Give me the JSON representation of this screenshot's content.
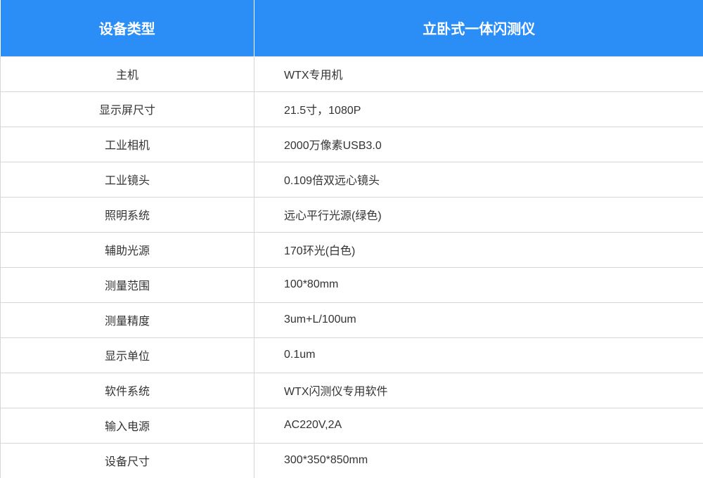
{
  "header": {
    "col1": "设备类型",
    "col2": "立卧式一体闪测仪"
  },
  "rows": [
    {
      "label": "主机",
      "value": "WTX专用机"
    },
    {
      "label": "显示屏尺寸",
      "value": "21.5寸，1080P"
    },
    {
      "label": "工业相机",
      "value": "2000万像素USB3.0"
    },
    {
      "label": "工业镜头",
      "value": "0.109倍双远心镜头"
    },
    {
      "label": "照明系统",
      "value": "远心平行光源(绿色)"
    },
    {
      "label": "辅助光源",
      "value": "170环光(白色)"
    },
    {
      "label": "测量范围",
      "value": "100*80mm"
    },
    {
      "label": "测量精度",
      "value": "3um+L/100um"
    },
    {
      "label": "显示单位",
      "value": "0.1um"
    },
    {
      "label": "软件系统",
      "value": "WTX闪测仪专用软件"
    },
    {
      "label": "输入电源",
      "value": "AC220V,2A"
    },
    {
      "label": "设备尺寸",
      "value": "300*350*850mm"
    }
  ],
  "colors": {
    "header_bg": "#2b8ef7",
    "header_text": "#ffffff",
    "border": "#d6d6d6",
    "body_text": "#333333"
  }
}
